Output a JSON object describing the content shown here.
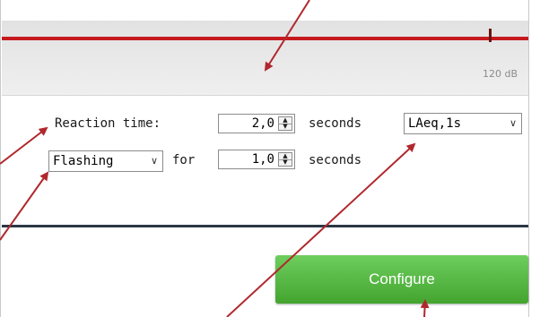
{
  "meter": {
    "scale_label": "120 dB"
  },
  "reaction": {
    "label": "Reaction time:",
    "value": "2,0",
    "unit": "seconds"
  },
  "flash": {
    "mode": "Flashing",
    "for_label": "for",
    "value": "1,0",
    "unit": "seconds"
  },
  "metric": {
    "selected": "LAeq,1s"
  },
  "configure": {
    "label": "Configure"
  },
  "colors": {
    "meter_line": "#c61a1f",
    "button": "#4cae38",
    "annotation_arrow": "#b0282d",
    "divider": "#2b3844"
  }
}
